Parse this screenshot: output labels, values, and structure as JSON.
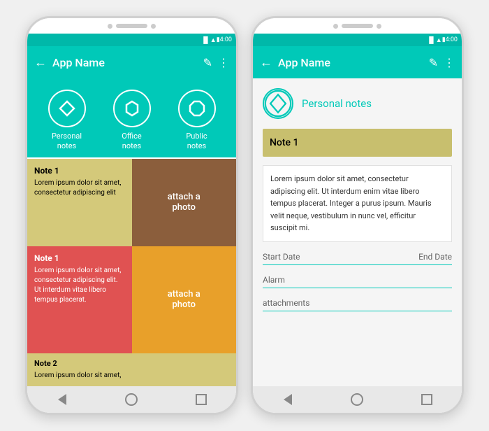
{
  "app": {
    "title": "App Name",
    "status_time": "4:00",
    "back_arrow": "←",
    "edit_icon": "✎",
    "more_icon": "⋮"
  },
  "left_phone": {
    "categories": [
      {
        "id": "personal",
        "label": "Personal\nnotes",
        "shape": "diamond"
      },
      {
        "id": "office",
        "label": "Office\nnotes",
        "shape": "hexagon"
      },
      {
        "id": "public",
        "label": "Public\nnotes",
        "shape": "octagon"
      }
    ],
    "notes": [
      {
        "id": "note1-yellow",
        "title": "Note 1",
        "body": "Lorem ipsum dolor sit amet, consectetur adipiscing elit",
        "style": "yellow"
      },
      {
        "id": "attach1",
        "label": "attach a\nphoto",
        "style": "brown"
      },
      {
        "id": "note1-red",
        "title": "Note 1",
        "body": "Lorem ipsum dolor sit amet, consectetur adipiscing elit. Ut interdum vitae libero tempus placerat.",
        "style": "red"
      },
      {
        "id": "attach2",
        "label": "attach a\nphoto",
        "style": "orange"
      },
      {
        "id": "note2-yellow",
        "title": "Note 2",
        "body": "Lorem ipsum dolor sit amet,",
        "style": "yellow-small"
      }
    ]
  },
  "right_phone": {
    "section_label": "Personal notes",
    "note_title": "Note 1",
    "note_body": "Lorem ipsum dolor sit amet, consectetur adipiscing elit. Ut interdum enim vitae libero tempus placerat. Integer a purus ipsum. Mauris velit neque, vestibulum in nunc vel, efficitur suscipit mi.",
    "fields": [
      {
        "id": "start-date",
        "label": "Start Date",
        "align": "left"
      },
      {
        "id": "end-date",
        "label": "End Date",
        "align": "right"
      },
      {
        "id": "alarm",
        "label": "Alarm"
      },
      {
        "id": "attachments",
        "label": "attachments"
      }
    ]
  }
}
